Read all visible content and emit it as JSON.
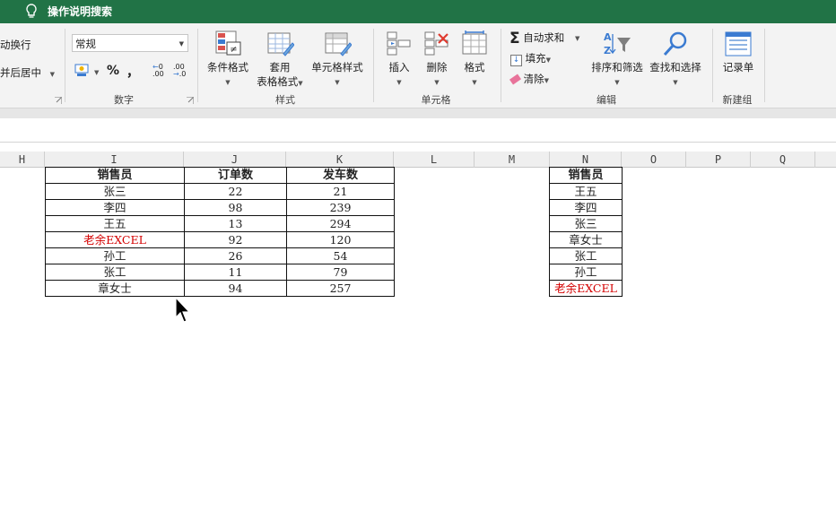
{
  "tell_me": {
    "label": "操作说明搜索",
    "icon": "lightbulb-icon"
  },
  "ribbon": {
    "alignment": {
      "wrap_text": "动换行",
      "merge_center": "并后居中"
    },
    "number": {
      "format_value": "常规",
      "percent": "%",
      "comma": "，",
      "increase_decimal": ".00",
      "decrease_decimal": ".0",
      "group_label": "数字"
    },
    "styles": {
      "conditional_format": "条件格式",
      "format_as_table_line1": "套用",
      "format_as_table_line2": "表格格式",
      "cell_styles": "单元格样式",
      "group_label": "样式"
    },
    "cells": {
      "insert": "插入",
      "delete": "删除",
      "format": "格式",
      "group_label": "单元格"
    },
    "editing": {
      "autosum": "自动求和",
      "fill": "填充",
      "clear": "清除",
      "sort_filter": "排序和筛选",
      "find_select": "查找和选择",
      "group_label": "编辑"
    },
    "new_group": {
      "form": "记录单",
      "group_label": "新建组"
    }
  },
  "sheet": {
    "columns": [
      "H",
      "I",
      "J",
      "K",
      "L",
      "M",
      "N",
      "O",
      "P",
      "Q"
    ],
    "table1": {
      "headers": [
        "销售员",
        "订单数",
        "发车数"
      ],
      "rows": [
        [
          "张三",
          "22",
          "21"
        ],
        [
          "李四",
          "98",
          "239"
        ],
        [
          "王五",
          "13",
          "294"
        ],
        [
          "老余EXCEL",
          "92",
          "120"
        ],
        [
          "孙工",
          "26",
          "54"
        ],
        [
          "张工",
          "11",
          "79"
        ],
        [
          "章女士",
          "94",
          "257"
        ]
      ],
      "highlight_row": 3
    },
    "table2": {
      "header": "销售员",
      "rows": [
        "王五",
        "李四",
        "张三",
        "章女士",
        "张工",
        "孙工",
        "老余EXCEL"
      ],
      "highlight_row": 6
    },
    "highlight_color": "#d40000",
    "theme_color": "#217346"
  }
}
